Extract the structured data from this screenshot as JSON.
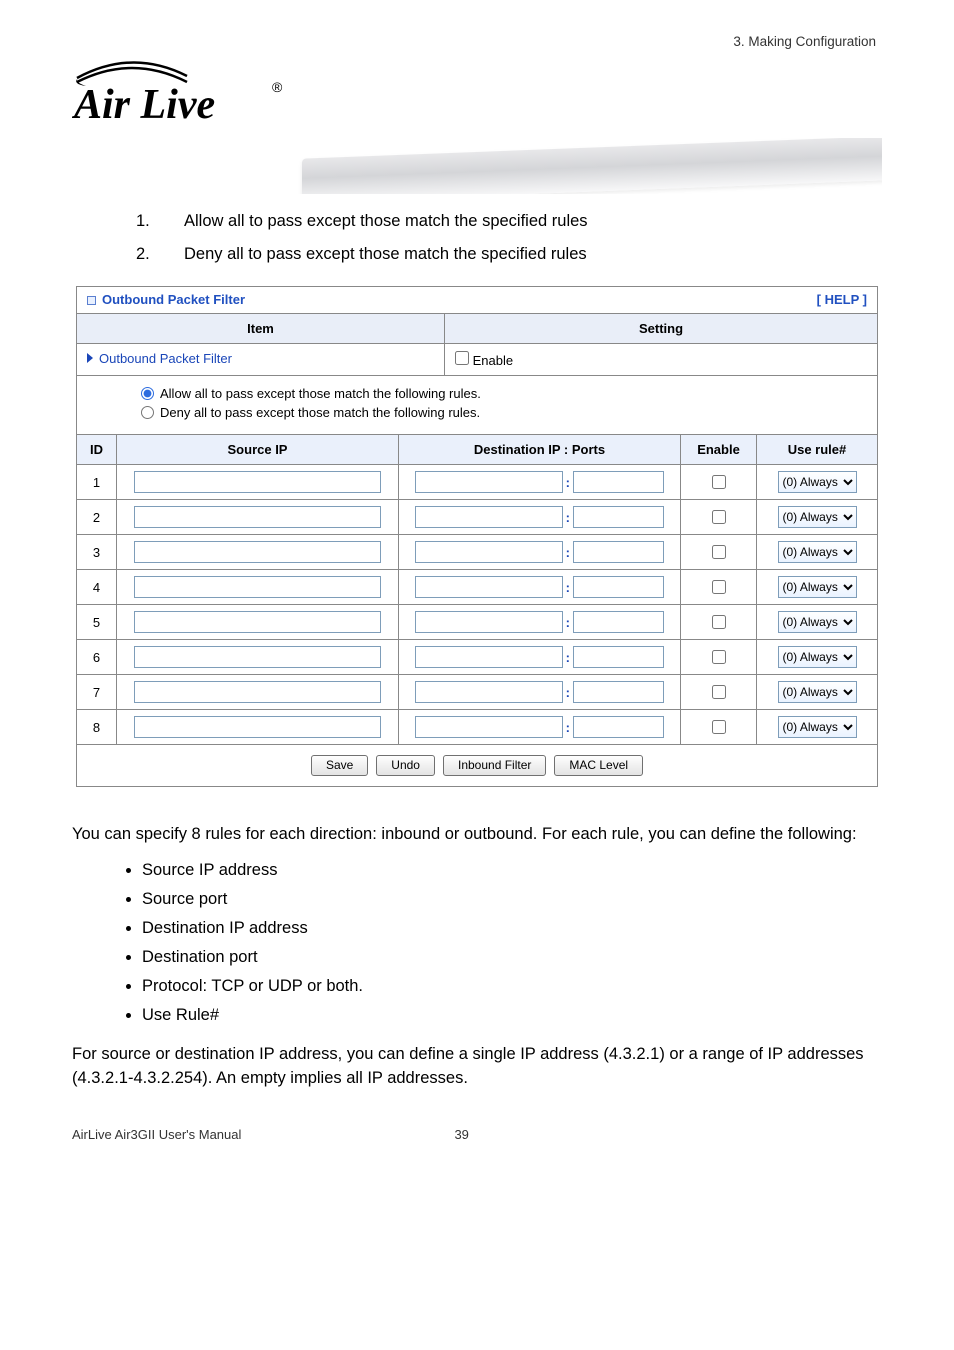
{
  "header": {
    "crumb": "3.  Making  Configuration"
  },
  "logo": {
    "brand_top": "Air",
    "brand_bottom": "Live",
    "tm": "®"
  },
  "steps": [
    {
      "n": "1.",
      "t": "Allow all to pass except those match the specified rules"
    },
    {
      "n": "2.",
      "t": "Deny all to pass except those match the specified rules"
    }
  ],
  "panel": {
    "title": "Outbound Packet Filter",
    "help": "[ HELP ]",
    "item_h": "Item",
    "setting_h": "Setting",
    "opf_label": "Outbound Packet Filter",
    "enable_label": "Enable",
    "mode_allow": "Allow all to pass except those match the following rules.",
    "mode_deny": "Deny all to pass except those match the following rules.",
    "cols": {
      "id": "ID",
      "src": "Source IP",
      "dst": "Destination IP : Ports",
      "en": "Enable",
      "rule": "Use rule#"
    },
    "rows": [
      {
        "id": "1",
        "rule": "(0) Always"
      },
      {
        "id": "2",
        "rule": "(0) Always"
      },
      {
        "id": "3",
        "rule": "(0) Always"
      },
      {
        "id": "4",
        "rule": "(0) Always"
      },
      {
        "id": "5",
        "rule": "(0) Always"
      },
      {
        "id": "6",
        "rule": "(0) Always"
      },
      {
        "id": "7",
        "rule": "(0) Always"
      },
      {
        "id": "8",
        "rule": "(0) Always"
      }
    ],
    "btn_save": "Save",
    "btn_undo": "Undo",
    "btn_inbound": "Inbound Filter",
    "btn_mac": "MAC Level"
  },
  "para1": "You can specify 8 rules for each direction: inbound or outbound. For each rule, you can define the following:",
  "bullets": [
    "Source IP address",
    "Source port",
    "Destination IP address",
    "Destination port",
    "Protocol: TCP or UDP or both.",
    "Use Rule#"
  ],
  "para2": "For source or destination IP address, you can define a single IP address (4.3.2.1) or a range of IP addresses (4.3.2.1-4.3.2.254). An empty implies all IP addresses.",
  "footer": {
    "left": "AirLive Air3GII User's Manual",
    "page": "39"
  }
}
